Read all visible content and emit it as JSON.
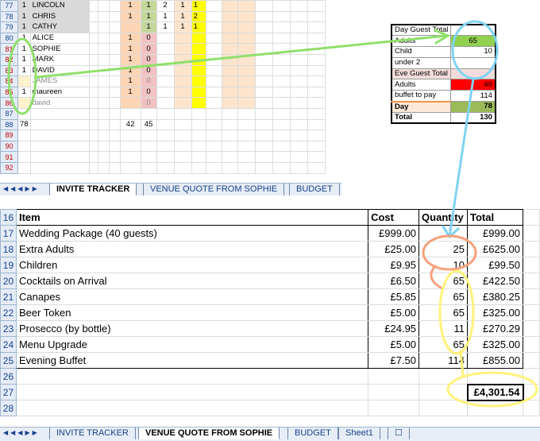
{
  "tracker": {
    "rows": [
      {
        "row": "77",
        "a": "1",
        "name": "LINCOLN",
        "f": "1",
        "g": "1",
        "h": "2",
        "i": "1",
        "j": "1",
        "grey": true
      },
      {
        "row": "78",
        "a": "1",
        "name": "CHRIS",
        "f": "1",
        "g": "1",
        "h": "1",
        "i": "1",
        "j": "2",
        "grey": true
      },
      {
        "row": "79",
        "a": "1",
        "name": "CATHY",
        "f": "",
        "g": "1",
        "h": "1",
        "i": "1",
        "j": "1",
        "grey": true
      },
      {
        "row": "80",
        "a": "1",
        "name": "ALICE",
        "f": "1",
        "g": "0",
        "h": "",
        "i": "",
        "j": ""
      },
      {
        "row": "81",
        "a": "1",
        "name": "SOPHIE",
        "f": "1",
        "g": "0",
        "h": "",
        "i": "",
        "j": ""
      },
      {
        "row": "82",
        "a": "1",
        "name": "MARK",
        "f": "1",
        "g": "0",
        "h": "",
        "i": "",
        "j": ""
      },
      {
        "row": "83",
        "a": "1",
        "name": "DAVID",
        "f": "1",
        "g": "0",
        "h": "",
        "i": "",
        "j": ""
      },
      {
        "row": "84",
        "a": "",
        "name": "JAMES",
        "f": "1",
        "g": "0",
        "h": "",
        "i": "",
        "j": "",
        "dim": true
      },
      {
        "row": "85",
        "a": "1",
        "name": "maureen",
        "f": "1",
        "g": "0",
        "h": "",
        "i": "",
        "j": ""
      },
      {
        "row": "86",
        "a": "",
        "name": "david",
        "f": "",
        "g": "0",
        "h": "",
        "i": "",
        "j": "",
        "dim": true
      },
      {
        "row": "87",
        "a": "",
        "name": "",
        "f": "",
        "g": "",
        "h": "",
        "i": "",
        "j": ""
      },
      {
        "row": "88",
        "a": "78",
        "name": "",
        "f": "42",
        "g": "45",
        "h": "",
        "i": "",
        "j": ""
      },
      {
        "row": "89",
        "a": "",
        "name": "",
        "f": "",
        "g": "",
        "h": "",
        "i": "",
        "j": ""
      },
      {
        "row": "90",
        "a": "",
        "name": "",
        "f": "",
        "g": "",
        "h": "",
        "i": "",
        "j": ""
      },
      {
        "row": "91",
        "a": "",
        "name": "",
        "f": "",
        "g": "",
        "h": "",
        "i": "",
        "j": ""
      },
      {
        "row": "92",
        "a": "",
        "name": "",
        "f": "",
        "g": "",
        "h": "",
        "i": "",
        "j": ""
      }
    ],
    "tabs": [
      "INVITE TRACKER",
      "VENUE QUOTE FROM SOPHIE",
      "BUDGET"
    ],
    "active_tab": "INVITE TRACKER"
  },
  "guest_box": {
    "rows": [
      {
        "label": "Day Guest Total",
        "value": ""
      },
      {
        "label": "Adults",
        "value": "65",
        "style": "grn"
      },
      {
        "label": "Child",
        "value": "10"
      },
      {
        "label": "under 2",
        "value": ""
      },
      {
        "label": "Eve Guest Total",
        "value": "",
        "style": "grey"
      },
      {
        "label": "Adults",
        "value": "49",
        "style": "red"
      },
      {
        "label": "buffet to pay",
        "value": "114"
      },
      {
        "label": "Day",
        "value": "78",
        "style": "day"
      },
      {
        "label": "Total",
        "value": "130",
        "bold": true
      }
    ]
  },
  "quote": {
    "header": {
      "row": "16",
      "item": "Item",
      "cost": "Cost",
      "quantity": "Quantity",
      "total": "Total"
    },
    "rows": [
      {
        "row": "17",
        "item": "Wedding Package (40 guests)",
        "cost": "£999.00",
        "quantity": "",
        "total": "£999.00"
      },
      {
        "row": "18",
        "item": "Extra Adults",
        "cost": "£25.00",
        "quantity": "25",
        "total": "£625.00"
      },
      {
        "row": "19",
        "item": "Children",
        "cost": "£9.95",
        "quantity": "10",
        "total": "£99.50"
      },
      {
        "row": "20",
        "item": "Cocktails on Arrival",
        "cost": "£6.50",
        "quantity": "65",
        "total": "£422.50"
      },
      {
        "row": "21",
        "item": "Canapes",
        "cost": "£5.85",
        "quantity": "65",
        "total": "£380.25"
      },
      {
        "row": "22",
        "item": "Beer Token",
        "cost": "£5.00",
        "quantity": "65",
        "total": "£325.00"
      },
      {
        "row": "23",
        "item": "Prosecco (by bottle)",
        "cost": "£24.95",
        "quantity": "11",
        "total": "£270.29"
      },
      {
        "row": "24",
        "item": "Menu Upgrade",
        "cost": "£5.00",
        "quantity": "65",
        "total": "£325.00"
      },
      {
        "row": "25",
        "item": "Evening Buffet",
        "cost": "£7.50",
        "quantity": "114",
        "total": "£855.00"
      }
    ],
    "blank_rows": [
      "26",
      "28"
    ],
    "total_row": "27",
    "grand_total": "£4,301.54",
    "tabs": [
      "INVITE TRACKER",
      "VENUE QUOTE FROM SOPHIE",
      "BUDGET",
      "Sheet1"
    ],
    "active_tab": "VENUE QUOTE FROM SOPHIE"
  },
  "colors": {
    "annot_green": "#8fe06a",
    "annot_blue": "#7fd3f0",
    "annot_orange": "#f7a07a",
    "annot_yellow": "#fff27a"
  }
}
